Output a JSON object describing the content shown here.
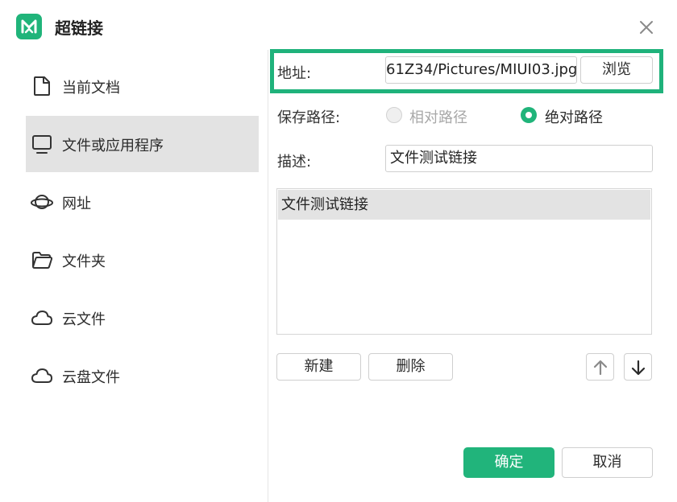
{
  "dialog": {
    "title": "超链接",
    "app_icon": "mindmaster-logo-icon",
    "close_icon": "close-icon"
  },
  "sidebar": {
    "items": [
      {
        "label": "当前文档",
        "icon": "document-icon",
        "active": false
      },
      {
        "label": "文件或应用程序",
        "icon": "monitor-icon",
        "active": true
      },
      {
        "label": "网址",
        "icon": "planet-icon",
        "active": false
      },
      {
        "label": "文件夹",
        "icon": "folder-icon",
        "active": false
      },
      {
        "label": "云文件",
        "icon": "cloud-icon",
        "active": false
      },
      {
        "label": "云盘文件",
        "icon": "cloud-icon",
        "active": false
      }
    ]
  },
  "form": {
    "address_label": "地址:",
    "address_value": "61Z34/Pictures/MIUI03.jpg",
    "browse_label": "浏览",
    "save_path_label": "保存路径:",
    "relative_path_label": "相对路径",
    "absolute_path_label": "绝对路径",
    "selected_path": "绝对路径",
    "description_label": "描述:",
    "description_value": "文件测试链接"
  },
  "link_list": {
    "items": [
      "文件测试链接"
    ]
  },
  "list_actions": {
    "new_label": "新建",
    "delete_label": "删除",
    "up_icon": "arrow-up-icon",
    "down_icon": "arrow-down-icon"
  },
  "footer": {
    "ok_label": "确定",
    "cancel_label": "取消"
  },
  "colors": {
    "accent": "#20b47a",
    "active_item_bg": "#e3e3e3",
    "border": "#cfcfcf"
  }
}
